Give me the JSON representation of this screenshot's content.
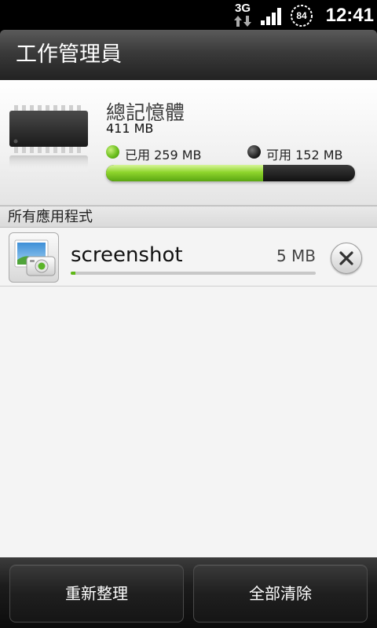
{
  "status_bar": {
    "network": "3G",
    "battery_level": "84",
    "time": "12:41"
  },
  "header": {
    "title": "工作管理員"
  },
  "memory": {
    "title": "總記憶體",
    "total": "411 MB",
    "used_label": "已用 259 MB",
    "free_label": "可用 152 MB",
    "used_fraction": 0.63,
    "colors": {
      "used": "#6cbf1e",
      "free": "#111111"
    }
  },
  "section": {
    "title": "所有應用程式"
  },
  "apps": [
    {
      "name": "screenshot",
      "size": "5 MB",
      "usage_fraction": 0.02,
      "icon": "camera-photo-icon"
    }
  ],
  "footer": {
    "refresh_label": "重新整理",
    "clear_all_label": "全部清除"
  }
}
